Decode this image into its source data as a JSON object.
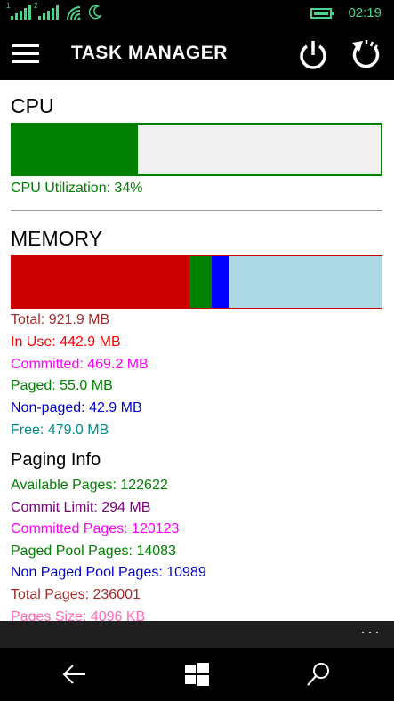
{
  "status_bar": {
    "time": "02:19",
    "sim1": "1",
    "sim2": "2"
  },
  "app_bar": {
    "title": "TASK MANAGER"
  },
  "cpu": {
    "title": "CPU",
    "utilization_text": "CPU Utilization: 34%",
    "utilization": 0.34
  },
  "memory": {
    "title": "MEMORY",
    "segments": [
      {
        "name": "in-use",
        "fraction": 0.48,
        "color": "#cc0000"
      },
      {
        "name": "paged",
        "fraction": 0.06,
        "color": "#008000"
      },
      {
        "name": "non-paged",
        "fraction": 0.047,
        "color": "#0000ff"
      },
      {
        "name": "free",
        "fraction": 0.413,
        "color": "#add8e6"
      }
    ],
    "lines": [
      {
        "text": "Total: 921.9 MB",
        "color": "#a52a2a"
      },
      {
        "text": "In Use: 442.9 MB",
        "color": "#ff0000"
      },
      {
        "text": "Committed: 469.2 MB",
        "color": "#ff00ff"
      },
      {
        "text": "Paged: 55.0 MB",
        "color": "#008000"
      },
      {
        "text": "Non-paged: 42.9 MB",
        "color": "#0000cd"
      },
      {
        "text": "Free: 479.0 MB",
        "color": "#008b8b"
      }
    ]
  },
  "paging": {
    "title": "Paging Info",
    "lines": [
      {
        "text": "Available Pages: 122622",
        "color": "#008000"
      },
      {
        "text": "Commit Limit: 294 MB",
        "color": "#800080"
      },
      {
        "text": "Committed Pages: 120123",
        "color": "#ff00ff"
      },
      {
        "text": "Paged Pool Pages: 14083",
        "color": "#008000"
      },
      {
        "text": "Non Paged Pool Pages: 10989",
        "color": "#0000cd"
      },
      {
        "text": "Total Pages: 236001",
        "color": "#a52a2a"
      },
      {
        "text": "Pages Size: 4096 KB",
        "color": "#ff69b4"
      }
    ]
  },
  "footer": {
    "more": "···"
  },
  "nav": {
    "icons": [
      "back-arrow-icon",
      "windows-start-icon",
      "search-icon"
    ]
  }
}
